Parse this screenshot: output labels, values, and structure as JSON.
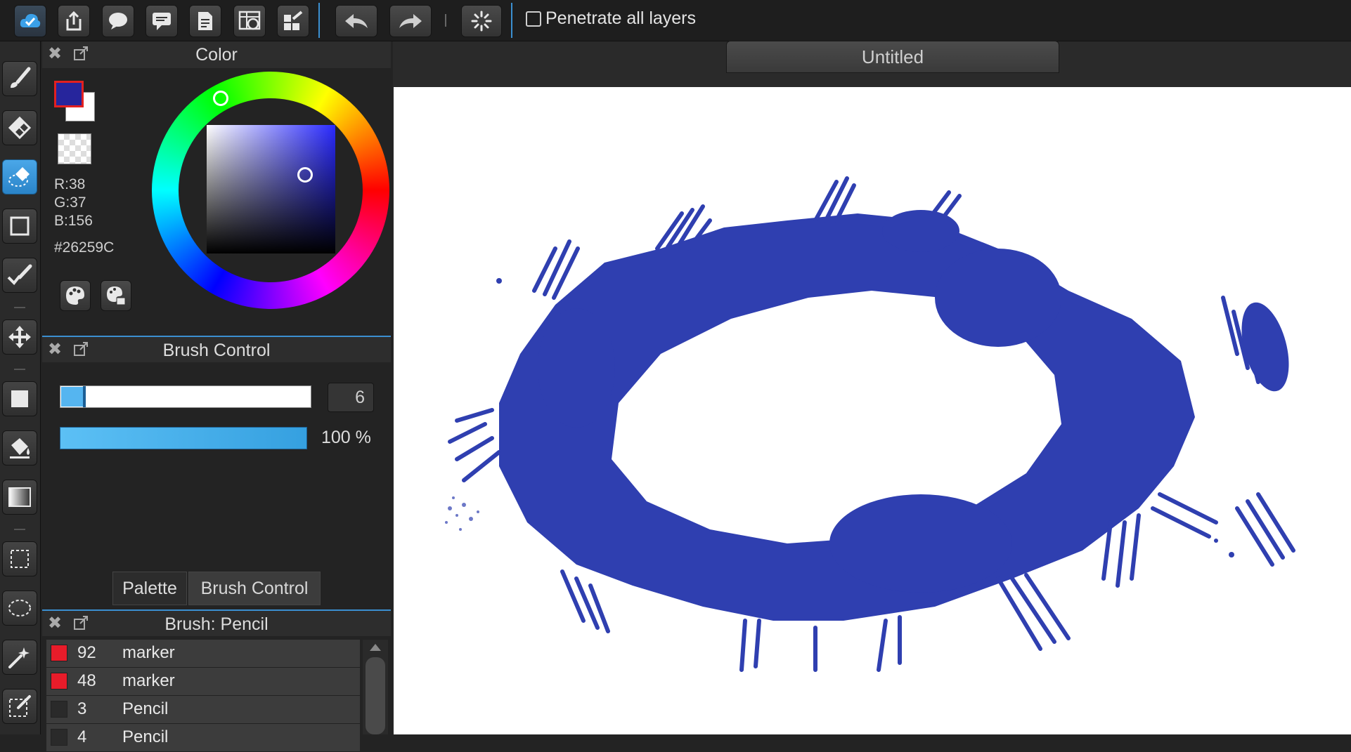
{
  "toolbar": {
    "buttons": [
      "cloud-icon",
      "share-icon",
      "chat-icon",
      "comment-icon",
      "document-icon",
      "grid-clock-icon",
      "checklist-icon",
      "undo-icon",
      "redo-icon",
      "spinner-icon"
    ],
    "penetrate_label": "Penetrate all layers",
    "penetrate_checked": false
  },
  "tools": [
    "brush-icon",
    "eraser-icon",
    "magic-eraser-icon",
    "rectangle-icon",
    "pen-stroke-icon",
    "move-icon",
    "fill-square-icon",
    "bucket-icon",
    "gradient-icon",
    "select-rect-icon",
    "lasso-icon",
    "magic-wand-icon",
    "transform-icon"
  ],
  "document": {
    "tab_title": "Untitled"
  },
  "color_panel": {
    "title": "Color",
    "r": "R:38",
    "g": "G:37",
    "b": "B:156",
    "hex": "#26259C",
    "foreground": "#26259c",
    "background": "#ffffff"
  },
  "brush_control": {
    "title": "Brush Control",
    "size_value": "6",
    "size_fraction": 0.09,
    "opacity_label": "100 %",
    "opacity": 1.0,
    "tabs": [
      "Palette",
      "Brush Control"
    ],
    "active_tab": "Brush Control"
  },
  "brush_panel": {
    "title": "Brush: Pencil",
    "items": [
      {
        "size": "92",
        "name": "marker",
        "color": "#e81c2a"
      },
      {
        "size": "48",
        "name": "marker",
        "color": "#e81c2a"
      },
      {
        "size": "3",
        "name": "Pencil",
        "color": "#2a2a2a"
      },
      {
        "size": "4",
        "name": "Pencil",
        "color": "#2a2a2a"
      }
    ]
  },
  "colors": {
    "accent": "#3b8fd0",
    "paint": "#2f3fb0"
  }
}
